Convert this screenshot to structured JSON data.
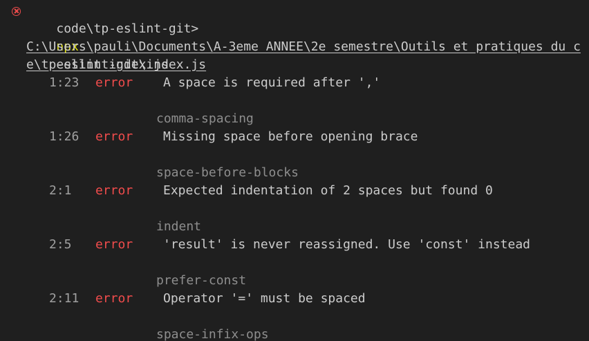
{
  "terminal": {
    "prompt": {
      "path": "code\\tp-eslint-git>",
      "command": "npx",
      "args": "eslint index.js"
    },
    "file_path_line1": "C:\\Users\\pauli\\Documents\\A-3eme ANNEE\\2e semestre\\Outils et pratiques du c",
    "file_path_line2": "e\\tp-eslint-git\\index.js",
    "problems": [
      {
        "position": "1:23",
        "severity": "error",
        "message": "A space is required after ','",
        "rule": "comma-spacing"
      },
      {
        "position": "1:26",
        "severity": "error",
        "message": "Missing space before opening brace",
        "rule": "space-before-blocks"
      },
      {
        "position": "2:1",
        "severity": "error",
        "message": "Expected indentation of 2 spaces but found 0",
        "rule": "indent"
      },
      {
        "position": "2:5",
        "severity": "error",
        "message": "'result' is never reassigned. Use 'const' instead",
        "rule": "prefer-const"
      },
      {
        "position": "2:11",
        "severity": "error",
        "message": "Operator '=' must be spaced",
        "rule": "space-infix-ops"
      }
    ],
    "icons": {
      "status": "error-circle-icon"
    },
    "colors": {
      "background": "#1f1f1f",
      "text": "#cccccc",
      "error": "#f14c4c",
      "command": "#e5e510",
      "rule": "#8e8e8e"
    }
  }
}
